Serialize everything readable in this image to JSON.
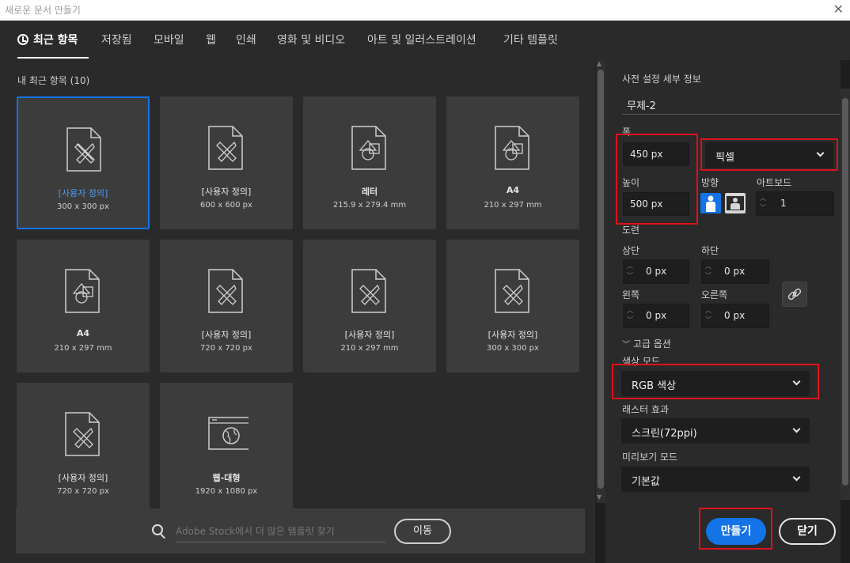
{
  "window": {
    "title": "새로운 문서 만들기",
    "close_glyph": "✕"
  },
  "tabs": [
    {
      "label": "최근 항목",
      "active": true
    },
    {
      "label": "저장됨"
    },
    {
      "label": "모바일"
    },
    {
      "label": "웹"
    },
    {
      "label": "인쇄"
    },
    {
      "label": "영화 및 비디오"
    },
    {
      "label": "아트 및 일러스트레이션"
    },
    {
      "label": "기타 템플릿"
    }
  ],
  "recent": {
    "title": "내 최근 항목 (10)",
    "items": [
      {
        "name": "[사용자 정의]",
        "size": "300 x 300 px",
        "icon": "doc-pencil-icon",
        "selected": true
      },
      {
        "name": "[사용자 정의]",
        "size": "600 x 600 px",
        "icon": "doc-pencil-icon"
      },
      {
        "name": "레터",
        "size": "215.9 x 279.4 mm",
        "icon": "doc-shapes-icon"
      },
      {
        "name": "A4",
        "size": "210 x 297 mm",
        "icon": "doc-shapes-icon"
      },
      {
        "name": "A4",
        "size": "210 x 297 mm",
        "icon": "doc-shapes-icon"
      },
      {
        "name": "[사용자 정의]",
        "size": "720 x 720 px",
        "icon": "doc-pencil-icon"
      },
      {
        "name": "[사용자 정의]",
        "size": "210 x 297 mm",
        "icon": "doc-pencil-icon"
      },
      {
        "name": "[사용자 정의]",
        "size": "300 x 300 px",
        "icon": "doc-pencil-icon"
      },
      {
        "name": "[사용자 정의]",
        "size": "720 x 720 px",
        "icon": "doc-pencil-icon"
      },
      {
        "name": "웹-대형",
        "size": "1920 x 1080 px",
        "icon": "browser-globe-icon"
      }
    ]
  },
  "search": {
    "placeholder": "Adobe Stock에서 더 많은 템플릿 찾기",
    "button": "이동"
  },
  "preset": {
    "heading": "사전 설정 세부 정보",
    "doc_name": "무제-2",
    "width_label": "폭",
    "width_value": "450 px",
    "unit": "픽셀",
    "height_label": "높이",
    "height_value": "500 px",
    "orientation_label": "방향",
    "artboard_label": "아트보드",
    "artboard_value": "1",
    "bleed_label": "도련",
    "top_label": "상단",
    "top_value": "0 px",
    "bottom_label": "하단",
    "bottom_value": "0 px",
    "left_label": "왼쪽",
    "left_value": "0 px",
    "right_label": "오른쪽",
    "right_value": "0 px",
    "advanced_label": "고급 옵션",
    "color_mode_label": "색상 모드",
    "color_mode_value": "RGB 색상",
    "raster_label": "래스터 효과",
    "raster_value": "스크린(72ppi)",
    "preview_label": "미리보기 모드",
    "preview_value": "기본값"
  },
  "actions": {
    "create": "만들기",
    "close": "닫기"
  },
  "colors": {
    "accent": "#1473e6",
    "highlight": "#e0101a"
  }
}
